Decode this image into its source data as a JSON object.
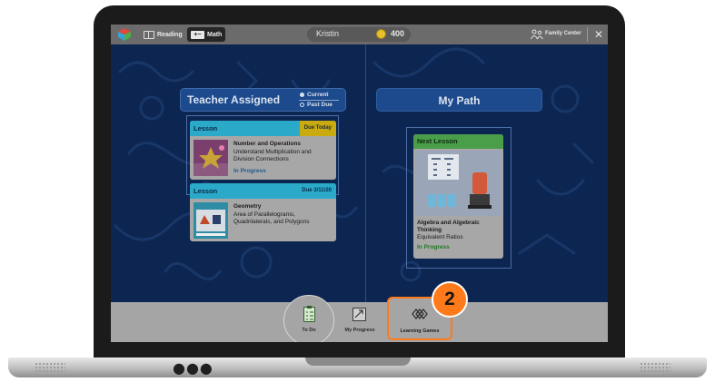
{
  "topbar": {
    "reading_tab": "Reading",
    "math_tab": "Math",
    "math_icon_text": "+−",
    "student_name": "Kristin",
    "coins": "400",
    "family_center": "Family Center",
    "close_glyph": "✕"
  },
  "teacher_assigned": {
    "title": "Teacher Assigned",
    "filter_current": "Current",
    "filter_past_due": "Past Due",
    "selected_filter": "Current",
    "cards": [
      {
        "type": "Lesson",
        "due": "Due Today",
        "subject": "Number and Operations",
        "description": "Understand Multiplication and Division Connections",
        "status": "In Progress"
      },
      {
        "type": "Lesson",
        "due": "Due 3/11/20",
        "subject": "Geometry",
        "description": "Area of Parallelograms, Quadrilaterals, and Polygons",
        "status": ""
      }
    ]
  },
  "my_path": {
    "title": "My Path",
    "card": {
      "type": "Next Lesson",
      "subject": "Algebra and Algebraic Thinking",
      "description": "Equivalent Ratios",
      "status": "In Progress"
    }
  },
  "bottom_nav": {
    "items": [
      {
        "label": "To Do",
        "icon": "checklist-icon"
      },
      {
        "label": "My Progress",
        "icon": "progress-chart-icon"
      },
      {
        "label": "Learning Games",
        "icon": "learning-games-icon"
      }
    ],
    "highlighted": "Learning Games"
  },
  "step_marker": "2",
  "colors": {
    "accent": "#ff7a1a",
    "lesson_header": "#2aa9c9",
    "next_lesson_header": "#4a9e4a",
    "due_today": "#c9aa0f",
    "screen_bg": "#0d2551"
  },
  "laptop_indicator": "●●●"
}
